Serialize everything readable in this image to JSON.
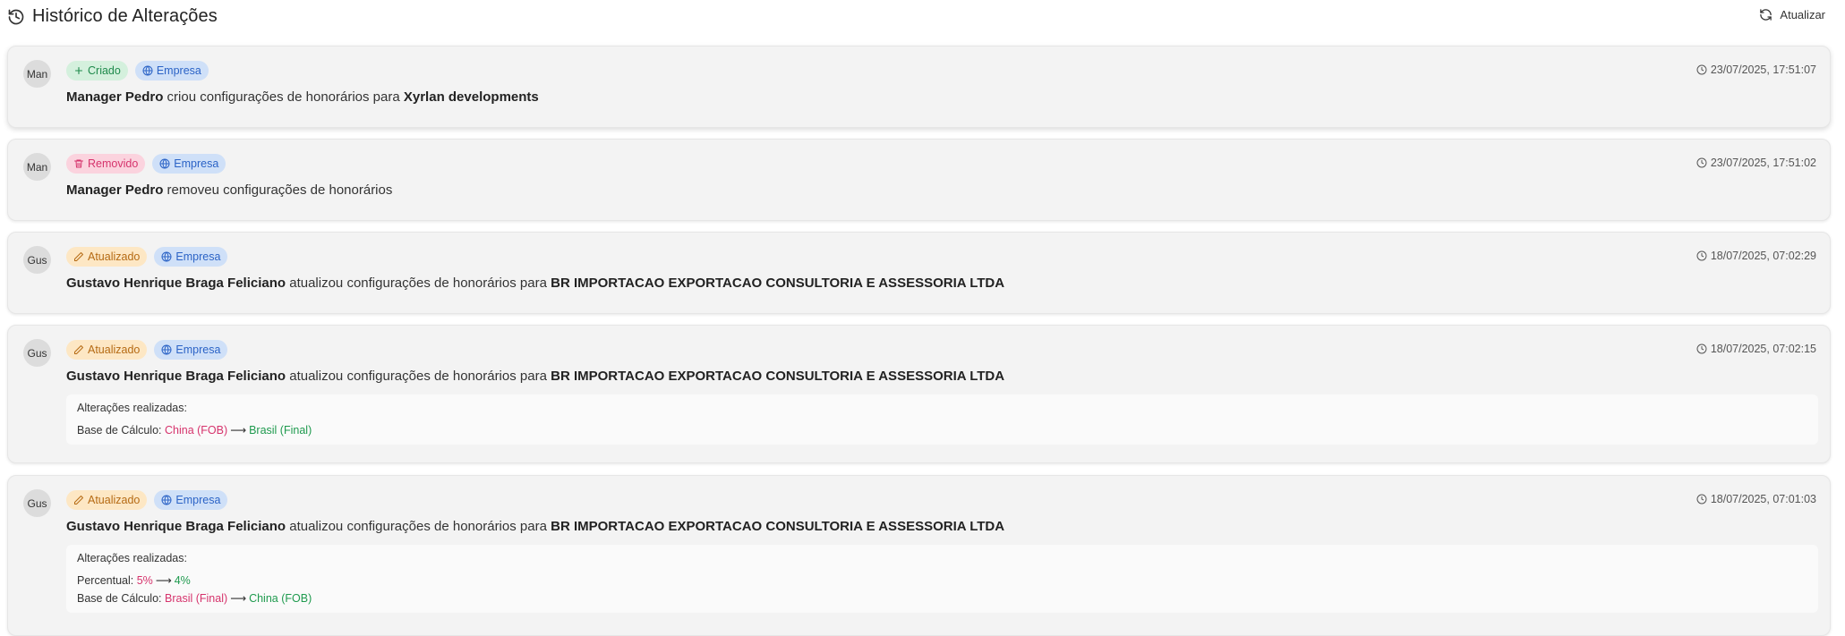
{
  "header": {
    "title": "Histórico de Alterações",
    "refresh_label": "Atualizar"
  },
  "entries": [
    {
      "avatar": "Man",
      "action_badge": "Criado",
      "entity_badge": "Empresa",
      "timestamp": "23/07/2025, 17:51:07",
      "user": "Manager Pedro",
      "action_text": "criou configurações de honorários para",
      "target": "Xyrlan developments"
    },
    {
      "avatar": "Man",
      "action_badge": "Removido",
      "entity_badge": "Empresa",
      "timestamp": "23/07/2025, 17:51:02",
      "user": "Manager Pedro",
      "action_text": "removeu configurações de honorários"
    },
    {
      "avatar": "Gus",
      "action_badge": "Atualizado",
      "entity_badge": "Empresa",
      "timestamp": "18/07/2025, 07:02:29",
      "user": "Gustavo Henrique Braga Feliciano",
      "action_text": "atualizou configurações de honorários para",
      "target": "BR IMPORTACAO EXPORTACAO CONSULTORIA E ASSESSORIA LTDA"
    },
    {
      "avatar": "Gus",
      "action_badge": "Atualizado",
      "entity_badge": "Empresa",
      "timestamp": "18/07/2025, 07:02:15",
      "user": "Gustavo Henrique Braga Feliciano",
      "action_text": "atualizou configurações de honorários para",
      "target": "BR IMPORTACAO EXPORTACAO CONSULTORIA E ASSESSORIA LTDA",
      "changes_title": "Alterações realizadas:",
      "changes": [
        {
          "field": "Base de Cálculo:",
          "old": "China (FOB)",
          "arrow": "⟶",
          "new": "Brasil (Final)"
        }
      ]
    },
    {
      "avatar": "Gus",
      "action_badge": "Atualizado",
      "entity_badge": "Empresa",
      "timestamp": "18/07/2025, 07:01:03",
      "user": "Gustavo Henrique Braga Feliciano",
      "action_text": "atualizou configurações de honorários para",
      "target": "BR IMPORTACAO EXPORTACAO CONSULTORIA E ASSESSORIA LTDA",
      "changes_title": "Alterações realizadas:",
      "changes": [
        {
          "field": "Percentual:",
          "old": "5%",
          "arrow": "⟶",
          "new": "4%"
        },
        {
          "field": "Base de Cálculo:",
          "old": "Brasil (Final)",
          "arrow": "⟶",
          "new": "China (FOB)"
        }
      ]
    }
  ],
  "colors": {
    "created": "#1f8a4c",
    "removed": "#d6336c",
    "updated": "#b56a13",
    "entity": "#2b63c6",
    "old_value": "#d6336c",
    "new_value": "#1f9a4e"
  }
}
